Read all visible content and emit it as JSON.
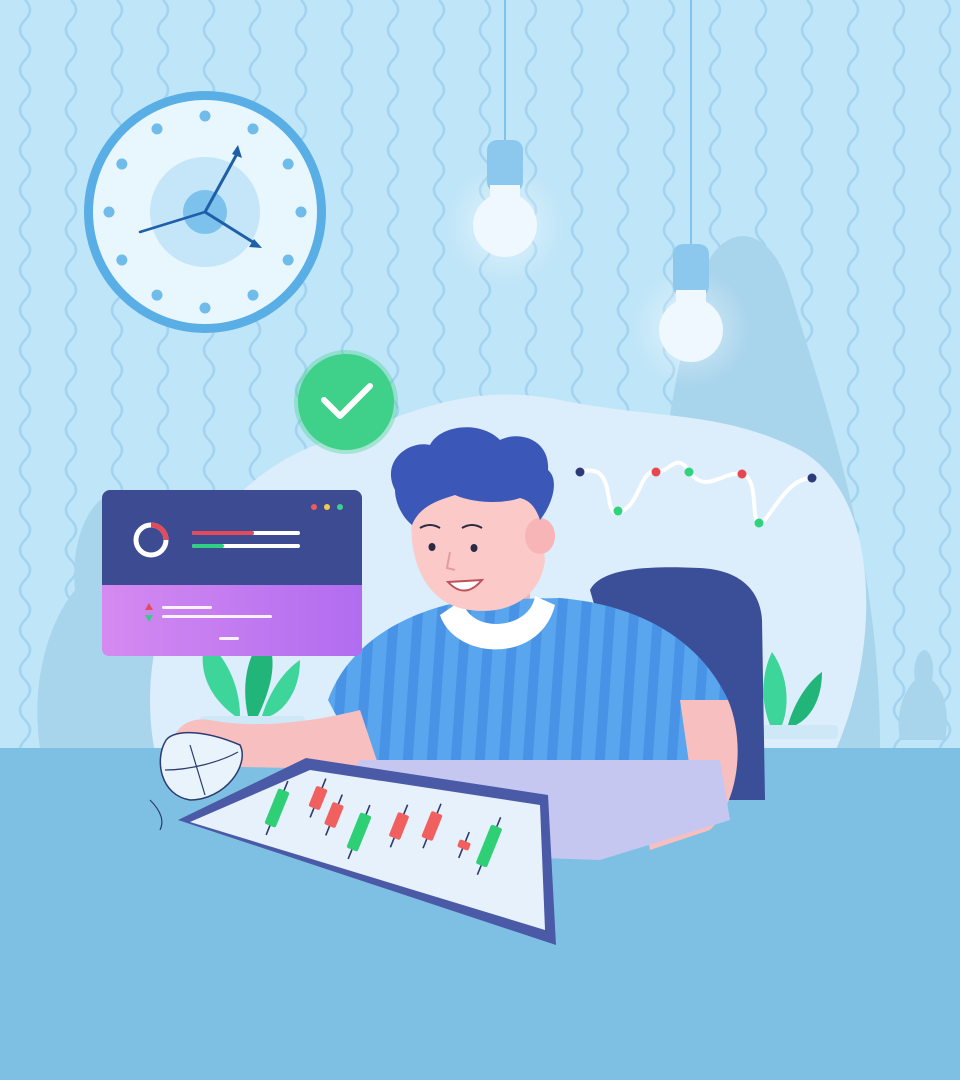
{
  "scene": {
    "colors": {
      "wall": "#bfe5f8",
      "wall_wave": "#9fd2ef",
      "floor": "#7ec0e3",
      "blob": "#dcedfb",
      "bush": "#a8d4ec",
      "plant_leaf": "#3dd59a",
      "plant_leaf_dark": "#22b57a",
      "clock_face": "#e8f6fd",
      "clock_rim": "#5aaee6",
      "clock_hand": "#1f5fa8",
      "bulb_socket": "#8cc8ee",
      "bulb_glass": "#eef8fe",
      "check_badge": "#3fd08a",
      "card_top": "#3d4b92",
      "card_bottom_start": "#d58af0",
      "card_bottom_end": "#b16cf0",
      "stat_red": "#e44a58",
      "stat_green": "#2fcf84",
      "shirt": "#5aa6ee",
      "shirt_stripe": "#3c84e0",
      "skin": "#fbc9c7",
      "hair": "#3b58b8",
      "chair": "#3a4f97",
      "tablet_frame": "#4a5aa7",
      "tablet_screen": "#e7f1fc",
      "candle_green": "#2fcf76",
      "candle_red": "#f0605f"
    },
    "icons": [
      "wall-clock-icon",
      "light-bulb-icon",
      "check-mark-icon",
      "donut-chart-icon",
      "computer-mouse-icon"
    ],
    "candles": [
      {
        "dir": "up"
      },
      {
        "dir": "down"
      },
      {
        "dir": "down"
      },
      {
        "dir": "up"
      },
      {
        "dir": "down"
      },
      {
        "dir": "down"
      },
      {
        "dir": "down"
      },
      {
        "dir": "up"
      }
    ],
    "wave_points": [
      {
        "color": "navy"
      },
      {
        "color": "green"
      },
      {
        "color": "red"
      },
      {
        "color": "green"
      },
      {
        "color": "red"
      },
      {
        "color": "green"
      },
      {
        "color": "navy"
      }
    ]
  }
}
